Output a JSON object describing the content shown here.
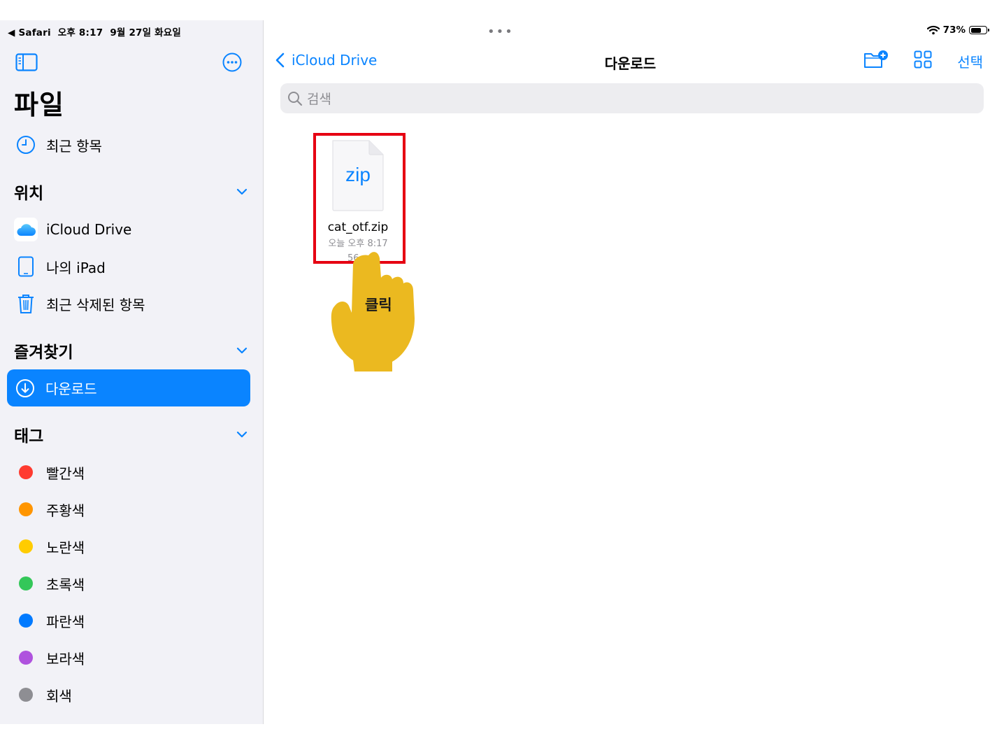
{
  "status_bar": {
    "back_app": "◀ Safari",
    "time": "오후 8:17",
    "date": "9월 27일 화요일",
    "multitask": "•••",
    "battery": "73%",
    "battery_level": 0.73
  },
  "sidebar": {
    "title": "파일",
    "recents": "최근 항목",
    "locations": {
      "header": "위치",
      "items": [
        "iCloud Drive",
        "나의 iPad",
        "최근 삭제된 항목"
      ]
    },
    "favorites": {
      "header": "즐겨찾기",
      "items": [
        "다운로드"
      ]
    },
    "tags": {
      "header": "태그",
      "items": [
        {
          "label": "빨간색",
          "color": "#ff3b30"
        },
        {
          "label": "주황색",
          "color": "#ff9500"
        },
        {
          "label": "노란색",
          "color": "#ffcc00"
        },
        {
          "label": "초록색",
          "color": "#34c759"
        },
        {
          "label": "파란색",
          "color": "#007aff"
        },
        {
          "label": "보라색",
          "color": "#af52de"
        },
        {
          "label": "회색",
          "color": "#8e8e93"
        }
      ]
    }
  },
  "main": {
    "back_label": "iCloud Drive",
    "title": "다운로드",
    "select_label": "선택",
    "search_placeholder": "검색",
    "file": {
      "icon_text": "zip",
      "name": "cat_otf.zip",
      "date": "오늘 오후 8:17",
      "size": "56"
    }
  },
  "annotation": {
    "label": "클릭",
    "highlight_color": "#e60012",
    "hand_color": "#ebb920"
  },
  "colors": {
    "accent": "#0a84ff",
    "sidebar_bg": "#f2f2f7"
  }
}
